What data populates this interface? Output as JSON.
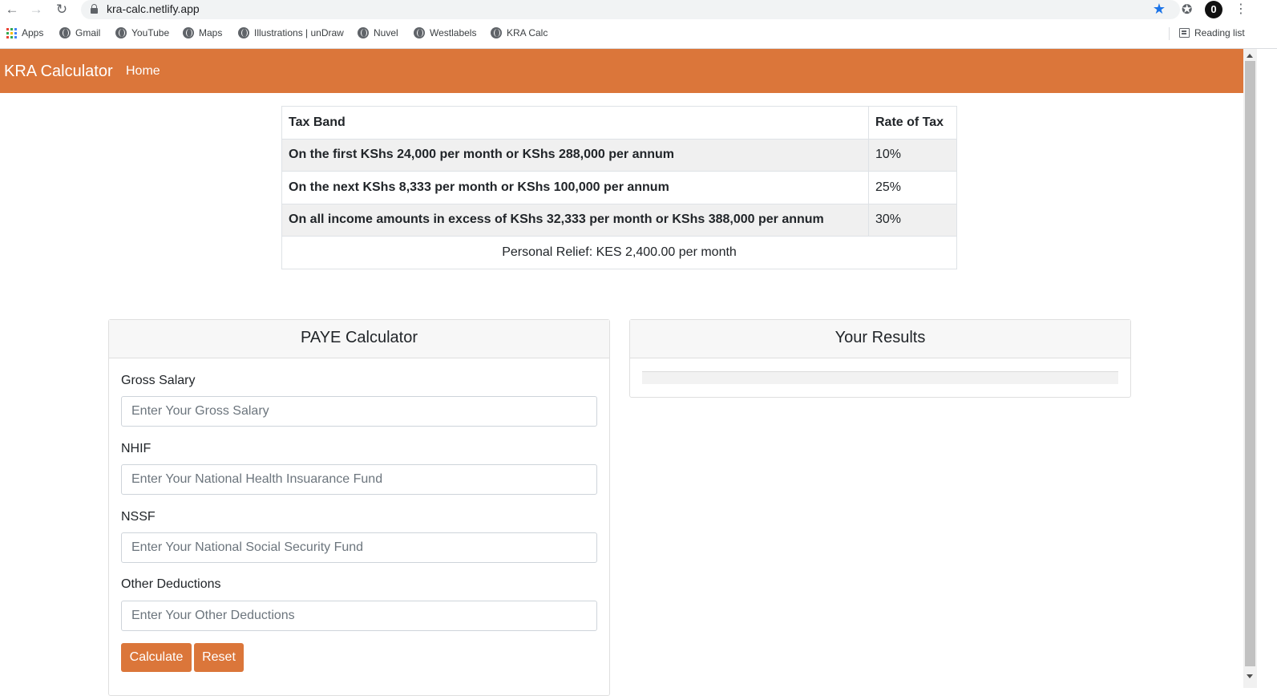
{
  "browser": {
    "url": "kra-calc.netlify.app",
    "bookmarks": [
      "Apps",
      "Gmail",
      "YouTube",
      "Maps",
      "Illustrations | unDraw",
      "Nuvel",
      "Westlabels",
      "KRA Calc"
    ],
    "reading_list": "Reading list",
    "profile_initial": "0"
  },
  "navbar": {
    "brand": "KRA Calculator",
    "home": "Home",
    "color": "#db763a"
  },
  "tax_table": {
    "headers": [
      "Tax Band",
      "Rate of Tax"
    ],
    "rows": [
      {
        "band": "On the first KShs 24,000 per month or KShs 288,000 per annum",
        "rate": "10%"
      },
      {
        "band": "On the next KShs 8,333 per month or KShs 100,000 per annum",
        "rate": "25%"
      },
      {
        "band": "On all income amounts in excess of KShs 32,333 per month or KShs 388,000 per annum",
        "rate": "30%"
      }
    ],
    "relief": "Personal Relief: KES 2,400.00 per month"
  },
  "calculator": {
    "title": "PAYE Calculator",
    "fields": [
      {
        "label": "Gross Salary",
        "placeholder": "Enter Your Gross Salary"
      },
      {
        "label": "NHIF",
        "placeholder": "Enter Your National Health Insuarance Fund"
      },
      {
        "label": "NSSF",
        "placeholder": "Enter Your National Social Security Fund"
      },
      {
        "label": "Other Deductions",
        "placeholder": "Enter Your Other Deductions"
      }
    ],
    "calculate_label": "Calculate",
    "reset_label": "Reset"
  },
  "results": {
    "title": "Your Results"
  }
}
